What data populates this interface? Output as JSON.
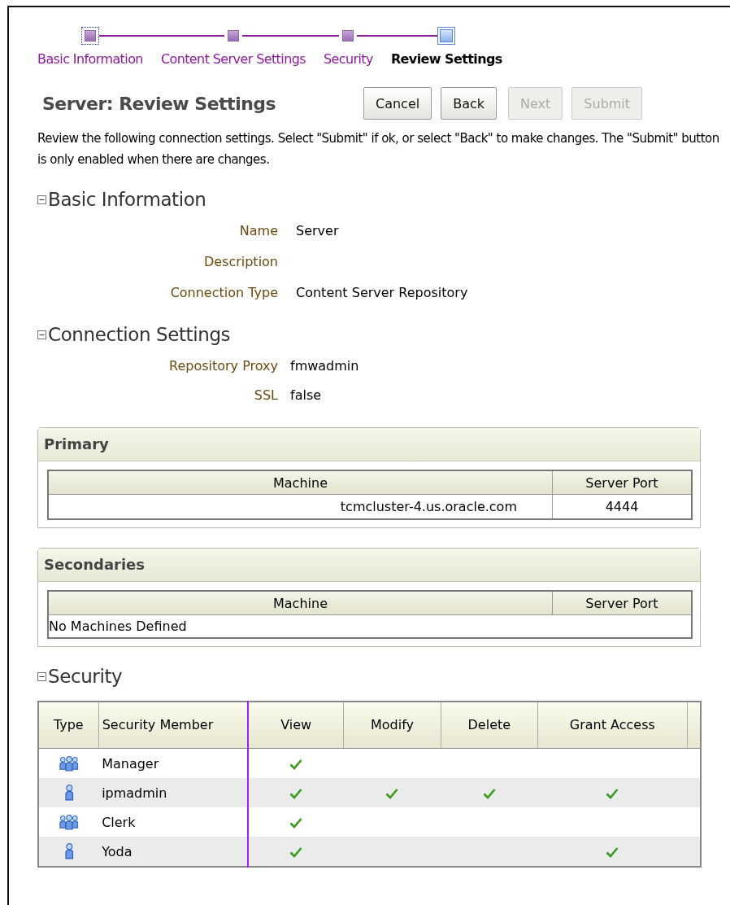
{
  "train": [
    {
      "label": "Basic Information",
      "selected": false,
      "focused": true
    },
    {
      "label": "Content Server Settings",
      "selected": false,
      "focused": false
    },
    {
      "label": "Security",
      "selected": false,
      "focused": false
    },
    {
      "label": "Review Settings",
      "selected": true,
      "focused": false
    }
  ],
  "title": "Server: Review Settings",
  "buttons": [
    {
      "label": "Cancel",
      "disabled": false
    },
    {
      "label": "Back",
      "disabled": false
    },
    {
      "label": "Next",
      "disabled": true
    },
    {
      "label": "Submit",
      "disabled": true
    }
  ],
  "description": "Review the following connection settings. Select \"Submit\" if ok, or select \"Back\" to make changes. The \"Submit\" button is only enabled when there are changes.",
  "sections": [
    {
      "heading": "Basic Information",
      "expanded": true,
      "fields": [
        {
          "label": "Name",
          "value": "Server"
        },
        {
          "label": "Description"
        },
        {
          "label": "Connection Type",
          "value": "Content Server Repository"
        }
      ]
    },
    {
      "heading": "Connection Settings",
      "expanded": true,
      "fields": [
        {
          "label": "Repository Proxy",
          "value": "fmwadmin"
        },
        {
          "label": "SSL",
          "value": "false"
        }
      ]
    }
  ],
  "panels": [
    {
      "title": "Primary",
      "columns": [
        "Machine",
        "Server Port"
      ],
      "rows": [
        [
          "tcmcluster-4.us.oracle.com",
          "4444"
        ]
      ]
    },
    {
      "title": "Secondaries",
      "columns": [
        "Machine",
        "Server Port"
      ],
      "empty_text": "No Machines Defined"
    }
  ],
  "security": {
    "heading": "Security",
    "expanded": true,
    "columns": [
      "Type",
      "Security Member",
      "View",
      "Modify",
      "Delete",
      "Grant Access"
    ],
    "rows": [
      {
        "kind": "group",
        "member": "Manager",
        "view": true,
        "modify": false,
        "delete": false,
        "grant": false
      },
      {
        "kind": "user",
        "member": "ipmadmin",
        "view": true,
        "modify": true,
        "delete": true,
        "grant": true
      },
      {
        "kind": "group",
        "member": "Clerk",
        "view": true,
        "modify": false,
        "delete": false,
        "grant": false
      },
      {
        "kind": "user",
        "member": "Yoda",
        "view": true,
        "modify": false,
        "delete": false,
        "grant": true
      }
    ]
  }
}
